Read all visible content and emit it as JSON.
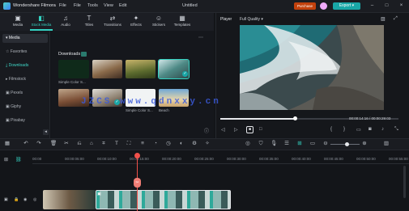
{
  "app": {
    "name": "Wondershare Filmora",
    "window_title": "Untitled"
  },
  "menu": [
    "File",
    "File",
    "Tools",
    "View",
    "Edit"
  ],
  "header": {
    "purchase": "Purchase",
    "export": "Export"
  },
  "tabs": [
    {
      "label": "Media",
      "icon": "media-icon"
    },
    {
      "label": "Stock Media",
      "icon": "stock-media-icon"
    },
    {
      "label": "Audio",
      "icon": "audio-icon"
    },
    {
      "label": "Titles",
      "icon": "titles-icon"
    },
    {
      "label": "Transitions",
      "icon": "transitions-icon"
    },
    {
      "label": "Effects",
      "icon": "effects-icon"
    },
    {
      "label": "Stickers",
      "icon": "stickers-icon"
    },
    {
      "label": "Templates",
      "icon": "templates-icon"
    }
  ],
  "sidebar": {
    "items": [
      {
        "label": "Media"
      },
      {
        "label": "Favorites"
      },
      {
        "label": "Downloads"
      },
      {
        "label": "Filmstock"
      },
      {
        "label": "Pexels"
      },
      {
        "label": "Giphy"
      },
      {
        "label": "Pixabay"
      }
    ]
  },
  "media": {
    "section": "Downloads",
    "labels": [
      "Simple Color S...",
      "Simple Color S...",
      "Beach"
    ]
  },
  "player": {
    "tab": "Player",
    "quality": "Full Quality",
    "current_time": "00:00:14:16",
    "total_time": "00:00:29:03",
    "progress": 0.42
  },
  "timeline": {
    "ruler": [
      "00:00",
      "00:00:05:00",
      "00:00:10:00",
      "00:00:15:00",
      "00:00:20:00",
      "00:00:25:00",
      "00:00:30:00",
      "00:00:35:00",
      "00:00:40:00",
      "00:00:45:00",
      "00:00:50:00",
      "00:00:55:00"
    ]
  },
  "watermark": "JZCS www.qdnxxy.cn",
  "colors": {
    "accent": "#34d3c2",
    "export": "#19a7a7",
    "purchase": "#c2410c",
    "playhead": "#f0504a",
    "clip": "#2fa99a"
  }
}
